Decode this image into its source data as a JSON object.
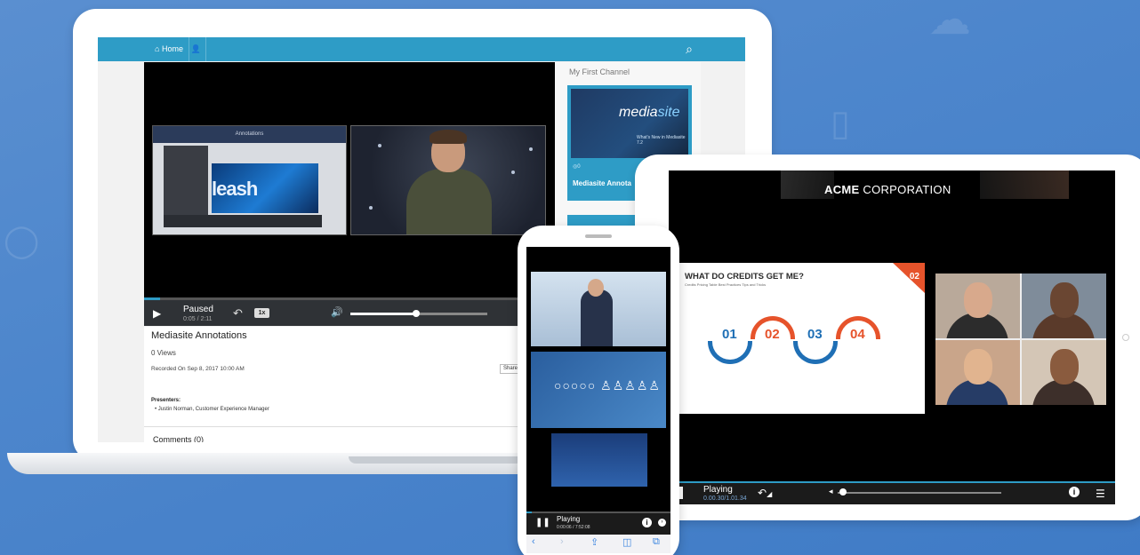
{
  "laptop": {
    "nav": {
      "home_label": "Home",
      "home_icon": "home-icon",
      "user_icon": "user-icon",
      "search_icon": "search-icon"
    },
    "annotations_panel_title": "Annotations",
    "annotations_slide_text": "leash",
    "player": {
      "status": "Paused",
      "time_current": "0:05",
      "time_total": "2:11",
      "speed": "1x",
      "volume": 0.48,
      "progress": 0.04
    },
    "info": {
      "title": "Mediasite Annotations",
      "views": "0 Views",
      "recorded": "Recorded On Sep 8, 2017 10:00 AM",
      "share": "Share",
      "presenters_heading": "Presenters:",
      "presenter": "Justin Norman, Customer Experience Manager",
      "comments": "Comments (0)"
    },
    "sidebar": {
      "title": "My First Channel",
      "card": {
        "logo_a": "media",
        "logo_b": "site",
        "subtitle": "What's New in Mediasite 7.2",
        "views": "0",
        "title": "Mediasite Annota"
      }
    }
  },
  "tablet": {
    "header_bold": "ACME",
    "header_rest": " CORPORATION",
    "slide": {
      "heading": "WHAT DO CREDITS GET ME?",
      "subheading": "Credits Pricing Table Best Practices Tips and Tricks",
      "number": "02",
      "steps": [
        "01",
        "02",
        "03",
        "04"
      ],
      "colors": {
        "blue": "#1f6fb5",
        "orange": "#e6532b"
      }
    },
    "player": {
      "status": "Playing",
      "time_current": "0.00.30",
      "time_total": "/1.01.34"
    }
  },
  "phone": {
    "player": {
      "status": "Playing",
      "time": "0:00:06 / 7:52:08"
    },
    "toolbar_icons": [
      "back-icon",
      "forward-icon",
      "share-icon",
      "bookmarks-icon",
      "tabs-icon"
    ]
  }
}
